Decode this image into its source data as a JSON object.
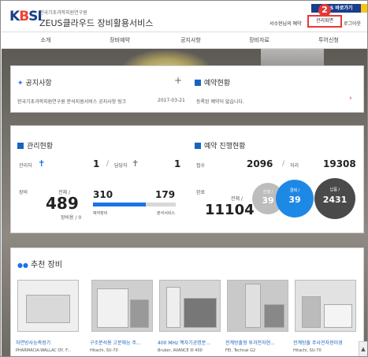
{
  "header": {
    "logo_part1": "K",
    "logo_part2": "B",
    "logo_part3": "SI",
    "org_name": "한국기초과학지원연구원",
    "site_title": "ZEUS클라우드 장비활용서비스",
    "badge": "ZEUS 바로가기",
    "step_number": "2",
    "welcome": "서수현님의 예약",
    "admin_link": "관리화면",
    "logout": "로그아웃"
  },
  "nav": {
    "items": [
      "소개",
      "장비예약",
      "공지사항",
      "장비자료",
      "투어신청"
    ]
  },
  "notice": {
    "title": "공지사항",
    "plus": "+",
    "item_text": "한국기초과학지원연구원 분석지원서비스 공지사항 링크",
    "item_date": "2017-03-21"
  },
  "reservation": {
    "title": "예약현황",
    "empty_text": "등록된 예약이 없습니다.",
    "arrow": "›"
  },
  "management": {
    "title": "관리현황",
    "admin_label": "관리자",
    "admin_count": "1",
    "manager_label": "담당자",
    "manager_count": "1",
    "equip_label": "장비",
    "total_label": "전체 /",
    "total_value": "489",
    "sub_label": "장비용 / 0",
    "reserve_value": "310",
    "reserve_label": "예약장비",
    "analysis_value": "179",
    "analysis_label": "분석서비스",
    "reserve_fraction": 0.634
  },
  "progress": {
    "title": "예약 진행현황",
    "receipt_label": "접수",
    "receipt_value": "2096",
    "process_label": "처리",
    "process_value": "19308",
    "complete_label": "완료",
    "total_label": "전체 /",
    "total_value": "11104",
    "circles": [
      {
        "label": "진행 /",
        "value": "39"
      },
      {
        "label": "결제 /",
        "value": "39"
      },
      {
        "label": "납품 /",
        "value": "2431"
      }
    ]
  },
  "recommend": {
    "title": "추천 장비",
    "items": [
      {
        "name": "자연방사능측정기",
        "maker": "PHARMACIA-WALLAC OY, F..."
      },
      {
        "name": "구조분석용 고분해능 주...",
        "maker": "Hitachi, SU-70"
      },
      {
        "name": "400 MHz 핵자기공명분...",
        "maker": "Bruker, AVANCE III 400"
      },
      {
        "name": "전계방출형 투과전자현...",
        "maker": "FEI, Technai G2"
      },
      {
        "name": "전계방출 주사전자현미경",
        "maker": "Hitachi, SU-70"
      }
    ]
  },
  "colors": {
    "brand_blue": "#1a3e8c",
    "accent_blue": "#1a73e8",
    "highlight_red": "#e53935"
  }
}
